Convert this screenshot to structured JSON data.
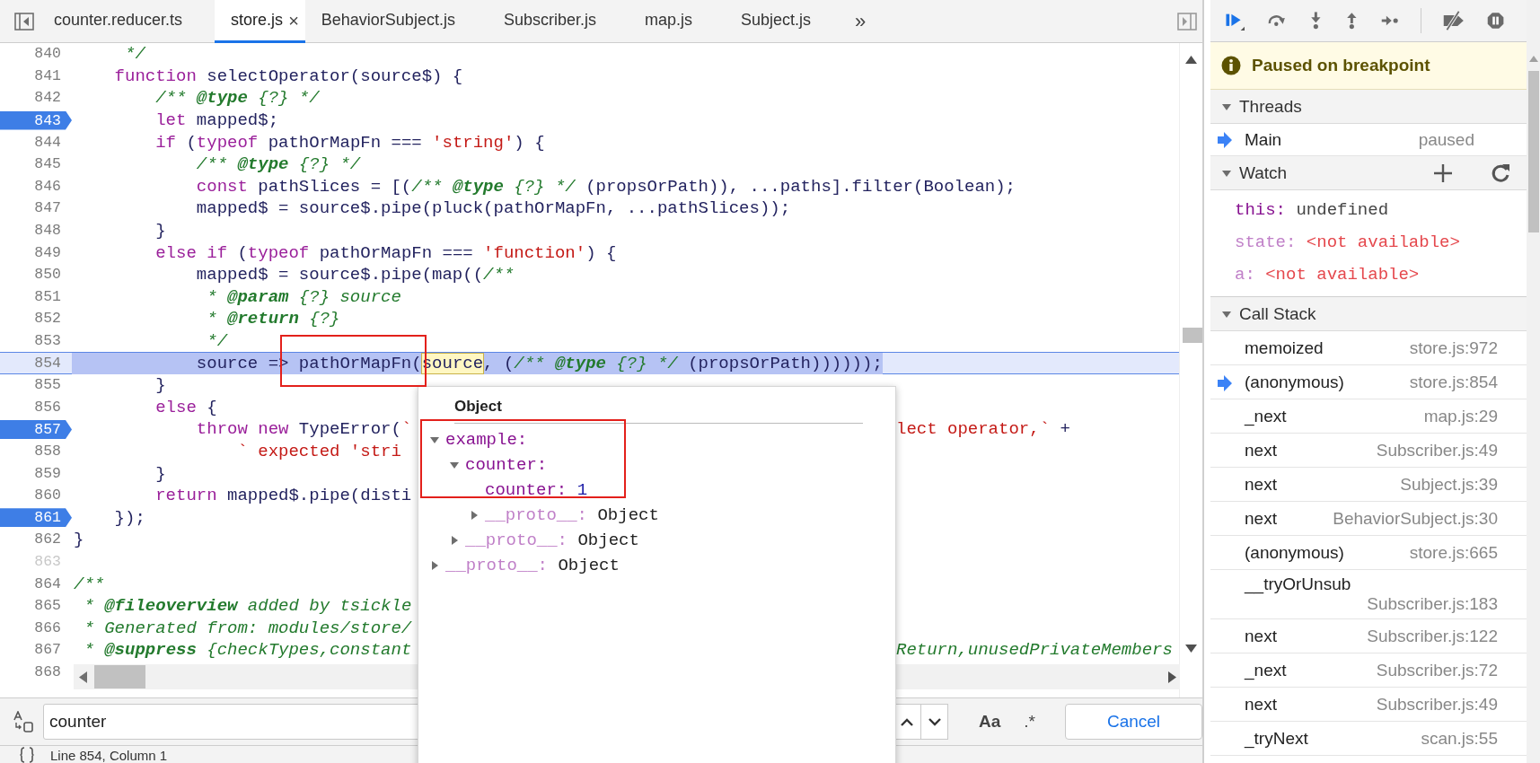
{
  "editor": {
    "tabs": [
      {
        "label": "counter.reducer.ts",
        "selected": false
      },
      {
        "label": "store.js",
        "selected": true,
        "close": "×"
      },
      {
        "label": "BehaviorSubject.js",
        "selected": false
      },
      {
        "label": "Subscriber.js",
        "selected": false
      },
      {
        "label": "map.js",
        "selected": false
      },
      {
        "label": "Subject.js",
        "selected": false
      }
    ],
    "more_tabs": "»",
    "lines": [
      {
        "number": "840",
        "breakpoint": false,
        "breakable": true,
        "current": false,
        "segments": [
          {
            "kind": "comment",
            "text": "     */"
          }
        ]
      },
      {
        "number": "841",
        "breakpoint": false,
        "breakable": true,
        "current": false,
        "segments": [
          {
            "kind": "keyword",
            "text": "    function"
          },
          {
            "kind": "plain",
            "text": " selectOperator(source$) {"
          }
        ]
      },
      {
        "number": "842",
        "breakpoint": false,
        "breakable": true,
        "current": false,
        "segments": [
          {
            "kind": "comment",
            "text": "        /** "
          },
          {
            "kind": "doctag",
            "text": "@type"
          },
          {
            "kind": "comment",
            "text": " {?} */"
          }
        ]
      },
      {
        "number": "843",
        "breakpoint": true,
        "breakable": true,
        "current": false,
        "segments": [
          {
            "kind": "keyword",
            "text": "        let"
          },
          {
            "kind": "plain",
            "text": " mapped$;"
          }
        ]
      },
      {
        "number": "844",
        "breakpoint": false,
        "breakable": true,
        "current": false,
        "segments": [
          {
            "kind": "keyword",
            "text": "        if"
          },
          {
            "kind": "plain",
            "text": " ("
          },
          {
            "kind": "keyword",
            "text": "typeof"
          },
          {
            "kind": "plain",
            "text": " pathOrMapFn === "
          },
          {
            "kind": "string",
            "text": "'string'"
          },
          {
            "kind": "plain",
            "text": ") {"
          }
        ]
      },
      {
        "number": "845",
        "breakpoint": false,
        "breakable": true,
        "current": false,
        "segments": [
          {
            "kind": "comment",
            "text": "            /** "
          },
          {
            "kind": "doctag",
            "text": "@type"
          },
          {
            "kind": "comment",
            "text": " {?} */"
          }
        ]
      },
      {
        "number": "846",
        "breakpoint": false,
        "breakable": true,
        "current": false,
        "segments": [
          {
            "kind": "keyword",
            "text": "            const"
          },
          {
            "kind": "plain",
            "text": " pathSlices = [("
          },
          {
            "kind": "comment",
            "text": "/** "
          },
          {
            "kind": "doctag",
            "text": "@type"
          },
          {
            "kind": "comment",
            "text": " {?} */"
          },
          {
            "kind": "plain",
            "text": " (propsOrPath)), ...paths].filter(Boolean);"
          }
        ]
      },
      {
        "number": "847",
        "breakpoint": false,
        "breakable": true,
        "current": false,
        "segments": [
          {
            "kind": "plain",
            "text": "            mapped$ = source$.pipe(pluck(pathOrMapFn, ...pathSlices));"
          }
        ]
      },
      {
        "number": "848",
        "breakpoint": false,
        "breakable": true,
        "current": false,
        "segments": [
          {
            "kind": "plain",
            "text": "        }"
          }
        ]
      },
      {
        "number": "849",
        "breakpoint": false,
        "breakable": true,
        "current": false,
        "segments": [
          {
            "kind": "keyword",
            "text": "        else if"
          },
          {
            "kind": "plain",
            "text": " ("
          },
          {
            "kind": "keyword",
            "text": "typeof"
          },
          {
            "kind": "plain",
            "text": " pathOrMapFn === "
          },
          {
            "kind": "string",
            "text": "'function'"
          },
          {
            "kind": "plain",
            "text": ") {"
          }
        ]
      },
      {
        "number": "850",
        "breakpoint": false,
        "breakable": true,
        "current": false,
        "segments": [
          {
            "kind": "plain",
            "text": "            mapped$ = source$.pipe(map(("
          },
          {
            "kind": "comment",
            "text": "/**"
          }
        ]
      },
      {
        "number": "851",
        "breakpoint": false,
        "breakable": true,
        "current": false,
        "segments": [
          {
            "kind": "comment",
            "text": "             * "
          },
          {
            "kind": "doctag",
            "text": "@param"
          },
          {
            "kind": "comment",
            "text": " {?} source"
          }
        ]
      },
      {
        "number": "852",
        "breakpoint": false,
        "breakable": true,
        "current": false,
        "segments": [
          {
            "kind": "comment",
            "text": "             * "
          },
          {
            "kind": "doctag",
            "text": "@return"
          },
          {
            "kind": "comment",
            "text": " {?}"
          }
        ]
      },
      {
        "number": "853",
        "breakpoint": false,
        "breakable": true,
        "current": false,
        "segments": [
          {
            "kind": "comment",
            "text": "             */"
          }
        ]
      },
      {
        "number": "854",
        "breakpoint": false,
        "breakable": true,
        "current": true,
        "segments": [
          {
            "kind": "plain",
            "text": "            source => pathOrMapFn("
          },
          {
            "kind": "hover",
            "text": "source"
          },
          {
            "kind": "plain",
            "text": ", ("
          },
          {
            "kind": "comment",
            "text": "/** "
          },
          {
            "kind": "doctag",
            "text": "@type"
          },
          {
            "kind": "comment",
            "text": " {?} */"
          },
          {
            "kind": "plain",
            "text": " (propsOrPath))))));"
          }
        ]
      },
      {
        "number": "855",
        "breakpoint": false,
        "breakable": true,
        "current": false,
        "segments": [
          {
            "kind": "plain",
            "text": "        }"
          }
        ]
      },
      {
        "number": "856",
        "breakpoint": false,
        "breakable": true,
        "current": false,
        "segments": [
          {
            "kind": "keyword",
            "text": "        else"
          },
          {
            "kind": "plain",
            "text": " {"
          }
        ]
      },
      {
        "number": "857",
        "breakpoint": true,
        "breakable": true,
        "current": false,
        "segments": [
          {
            "kind": "keyword",
            "text": "            throw new"
          },
          {
            "kind": "plain",
            "text": " TypeError("
          },
          {
            "kind": "string",
            "text": "`"
          }
        ],
        "tail": [
          {
            "kind": "string",
            "text": "lect operator,`"
          },
          {
            "kind": "plain",
            "text": " +"
          }
        ]
      },
      {
        "number": "858",
        "breakpoint": false,
        "breakable": true,
        "current": false,
        "segments": [
          {
            "kind": "string",
            "text": "                ` expected 'stri"
          }
        ]
      },
      {
        "number": "859",
        "breakpoint": false,
        "breakable": true,
        "current": false,
        "segments": [
          {
            "kind": "plain",
            "text": "        }"
          }
        ]
      },
      {
        "number": "860",
        "breakpoint": false,
        "breakable": true,
        "current": false,
        "segments": [
          {
            "kind": "keyword",
            "text": "        return"
          },
          {
            "kind": "plain",
            "text": " mapped$.pipe(disti"
          }
        ]
      },
      {
        "number": "861",
        "breakpoint": true,
        "breakable": true,
        "current": false,
        "segments": [
          {
            "kind": "plain",
            "text": "    });"
          }
        ]
      },
      {
        "number": "862",
        "breakpoint": false,
        "breakable": true,
        "current": false,
        "segments": [
          {
            "kind": "plain",
            "text": "}"
          }
        ]
      },
      {
        "number": "863",
        "breakpoint": false,
        "breakable": false,
        "current": false
      },
      {
        "number": "864",
        "breakpoint": false,
        "breakable": true,
        "current": false,
        "segments": [
          {
            "kind": "comment",
            "text": "/**"
          }
        ]
      },
      {
        "number": "865",
        "breakpoint": false,
        "breakable": true,
        "current": false,
        "segments": [
          {
            "kind": "comment",
            "text": " * "
          },
          {
            "kind": "doctag",
            "text": "@fileoverview"
          },
          {
            "kind": "comment",
            "text": " added by tsickle"
          }
        ]
      },
      {
        "number": "866",
        "breakpoint": false,
        "breakable": true,
        "current": false,
        "segments": [
          {
            "kind": "comment",
            "text": " * Generated from: modules/store/"
          }
        ]
      },
      {
        "number": "867",
        "breakpoint": false,
        "breakable": true,
        "current": false,
        "segments": [
          {
            "kind": "comment",
            "text": " * "
          },
          {
            "kind": "doctag",
            "text": "@suppress"
          },
          {
            "kind": "comment",
            "text": " {checkTypes,constant"
          }
        ],
        "tail": [
          {
            "kind": "comment",
            "text": "Return,unusedPrivateMembers"
          }
        ]
      },
      {
        "number": "868",
        "breakpoint": false,
        "breakable": true,
        "current": false
      }
    ],
    "popup": {
      "title": "Object",
      "tree": [
        {
          "key": "example:",
          "own": true,
          "expanded": true,
          "children": [
            {
              "key": "counter:",
              "own": true,
              "expanded": true,
              "children": [
                {
                  "key": "counter:",
                  "own": true,
                  "value": "1",
                  "kind": "number"
                },
                {
                  "key": "__proto__:",
                  "own": false,
                  "value": "Object",
                  "kind": "object",
                  "expanded": false
                }
              ]
            },
            {
              "key": "__proto__:",
              "own": false,
              "value": "Object",
              "kind": "object",
              "expanded": false
            }
          ]
        },
        {
          "key": "__proto__:",
          "own": false,
          "value": "Object",
          "kind": "object",
          "expanded": false
        }
      ]
    },
    "find": {
      "value": "counter",
      "match_case": "Aa",
      "regex": ".*",
      "cancel": "Cancel"
    },
    "status": {
      "text": "Line 854, Column 1"
    }
  },
  "debugger": {
    "banner": "Paused on breakpoint",
    "threads": {
      "title": "Threads",
      "expanded": true,
      "items": [
        {
          "name": "Main",
          "status": "paused",
          "selected": true
        }
      ]
    },
    "watch": {
      "title": "Watch",
      "expanded": true,
      "items": [
        {
          "name": "this:",
          "value": "undefined",
          "available": true
        },
        {
          "name": "state:",
          "value": "<not available>",
          "available": false
        },
        {
          "name": "a:",
          "value": "<not available>",
          "available": false
        }
      ]
    },
    "call_stack": {
      "title": "Call Stack",
      "expanded": true,
      "frames": [
        {
          "name": "memoized",
          "location": "store.js:972",
          "selected": false
        },
        {
          "name": "(anonymous)",
          "location": "store.js:854",
          "selected": true
        },
        {
          "name": "_next",
          "location": "map.js:29",
          "selected": false
        },
        {
          "name": "next",
          "location": "Subscriber.js:49",
          "selected": false
        },
        {
          "name": "next",
          "location": "Subject.js:39",
          "selected": false
        },
        {
          "name": "next",
          "location": "BehaviorSubject.js:30",
          "selected": false
        },
        {
          "name": "(anonymous)",
          "location": "store.js:665",
          "selected": false
        },
        {
          "name": "__tryOrUnsub",
          "location": "Subscriber.js:183",
          "selected": false
        },
        {
          "name": "next",
          "location": "Subscriber.js:122",
          "selected": false
        },
        {
          "name": "_next",
          "location": "Subscriber.js:72",
          "selected": false
        },
        {
          "name": "next",
          "location": "Subscriber.js:49",
          "selected": false
        },
        {
          "name": "_tryNext",
          "location": "scan.js:55",
          "selected": false
        }
      ]
    }
  }
}
